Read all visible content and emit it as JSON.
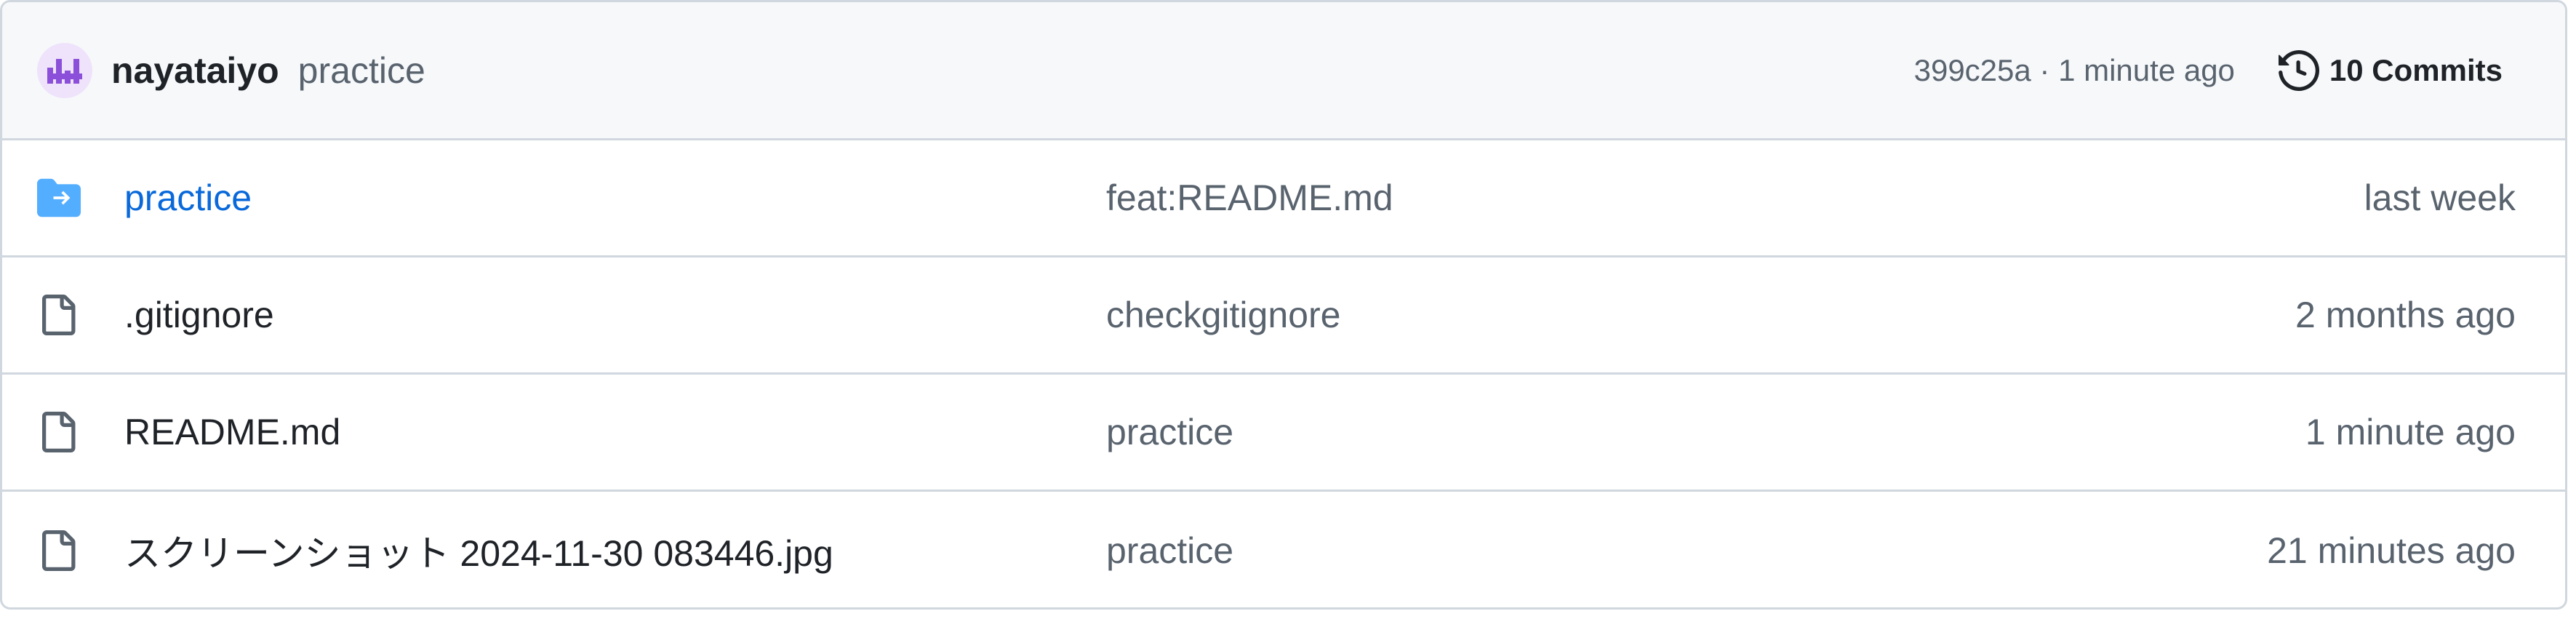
{
  "latest_commit": {
    "author": "nayataiyo",
    "message": "practice",
    "meta": "399c25a · 1 minute ago",
    "commits_label": "10 Commits"
  },
  "files": [
    {
      "name": "practice",
      "type": "dir",
      "icon": "folder-icon",
      "commit": "feat:README.md",
      "date": "last week"
    },
    {
      "name": ".gitignore",
      "type": "file",
      "icon": "file-icon",
      "commit": "checkgitignore",
      "date": "2 months ago"
    },
    {
      "name": "README.md",
      "type": "file",
      "icon": "file-icon",
      "commit": "practice",
      "date": "1 minute ago"
    },
    {
      "name": "スクリーンショット 2024-11-30 083446.jpg",
      "type": "file",
      "icon": "file-icon",
      "commit": "practice",
      "date": "21 minutes ago"
    }
  ],
  "colors": {
    "link": "#0969da",
    "muted": "#59636e",
    "avatar": "#8b4fd9",
    "folder": "#54aeff"
  }
}
